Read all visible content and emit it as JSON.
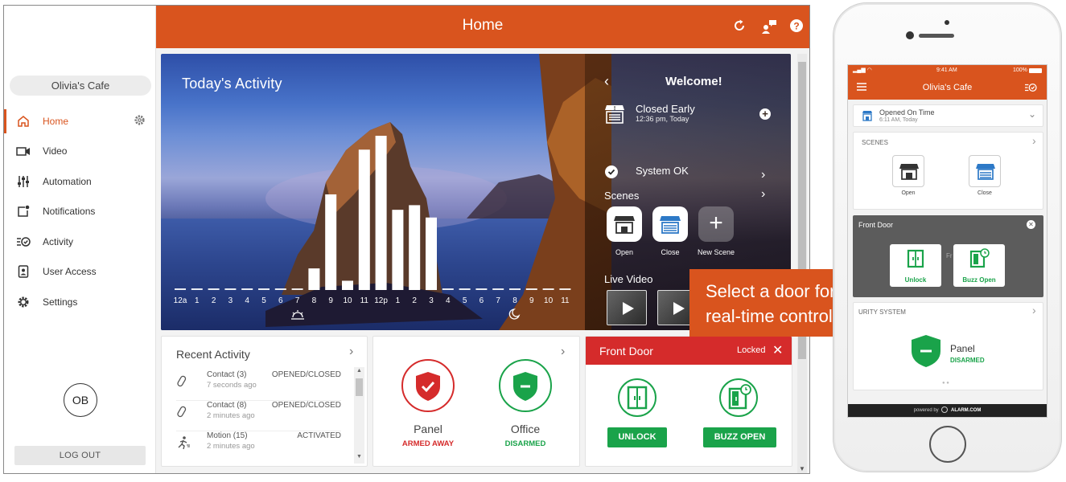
{
  "sidebar": {
    "location": "Olivia's Cafe",
    "items": [
      {
        "label": "Home",
        "icon": "home-icon",
        "active": true
      },
      {
        "label": "Video",
        "icon": "video-camera-icon"
      },
      {
        "label": "Automation",
        "icon": "sliders-icon"
      },
      {
        "label": "Notifications",
        "icon": "notification-icon"
      },
      {
        "label": "Activity",
        "icon": "activity-list-icon"
      },
      {
        "label": "User Access",
        "icon": "user-badge-icon"
      },
      {
        "label": "Settings",
        "icon": "gear-icon"
      }
    ],
    "avatar_initials": "OB",
    "logout_label": "LOG OUT"
  },
  "topbar": {
    "title": "Home"
  },
  "activity": {
    "title": "Today's Activity",
    "hours": [
      "12a",
      "1",
      "2",
      "3",
      "4",
      "5",
      "6",
      "7",
      "8",
      "9",
      "10",
      "11",
      "12p",
      "1",
      "2",
      "3",
      "4",
      "5",
      "6",
      "7",
      "8",
      "9",
      "10",
      "11"
    ],
    "levels": [
      0,
      0,
      0,
      0,
      0,
      0,
      0,
      0,
      0.14,
      0.62,
      0.06,
      0.91,
      1.0,
      0.52,
      0.55,
      0.47,
      0,
      0,
      0,
      0,
      0,
      0,
      0,
      0
    ]
  },
  "welcome": {
    "title": "Welcome!",
    "status": "Closed Early",
    "status_time": "12:36 pm, Today",
    "system": "System OK",
    "scenes_label": "Scenes",
    "scenes": [
      {
        "label": "Open",
        "icon": "storefront-open-icon"
      },
      {
        "label": "Close",
        "icon": "storefront-close-icon"
      },
      {
        "label": "New Scene",
        "icon": "plus-icon"
      }
    ],
    "live_video_label": "Live Video"
  },
  "recent_activity": {
    "title": "Recent Activity",
    "rows": [
      {
        "name": "Contact (3)",
        "time": "7 seconds ago",
        "state": "OPENED/CLOSED",
        "icon": "contact-sensor-icon"
      },
      {
        "name": "Contact (8)",
        "time": "2 minutes ago",
        "state": "OPENED/CLOSED",
        "icon": "contact-sensor-icon"
      },
      {
        "name": "Motion (15)",
        "time": "2 minutes ago",
        "state": "ACTIVATED",
        "icon": "motion-icon"
      }
    ]
  },
  "security": {
    "panel": {
      "name": "Panel",
      "state": "ARMED AWAY",
      "color": "#d52b2b"
    },
    "office": {
      "name": "Office",
      "state": "DISARMED",
      "color": "#1aa34a"
    }
  },
  "front_door": {
    "title": "Front Door",
    "status": "Locked",
    "unlock_label": "UNLOCK",
    "buzz_label": "BUZZ OPEN"
  },
  "callout": {
    "line1": "Select a door for",
    "line2": "real-time control"
  },
  "phone": {
    "time": "9:41 AM",
    "battery": "100%",
    "title": "Olivia's Cafe",
    "status": "Opened On Time",
    "status_time": "6:11 AM, Today",
    "scenes_label": "SCENES",
    "scenes": [
      "Open",
      "Close"
    ],
    "door_title": "Front Door",
    "door_under": "Fr",
    "unlock_label": "Unlock",
    "buzz_label": "Buzz Open",
    "security_label": "URITY SYSTEM",
    "panel_name": "Panel",
    "panel_state": "DISARMED",
    "powered": "powered by",
    "brand": "ALARM.COM"
  },
  "colors": {
    "accent": "#d9541e",
    "red": "#d52b2b",
    "green": "#1aa34a"
  }
}
